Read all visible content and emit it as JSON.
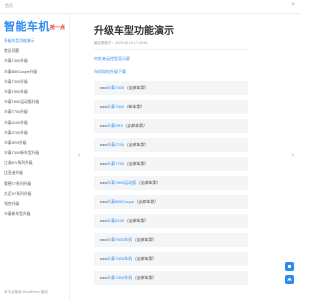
{
  "topbar": {
    "home": "首页",
    "close": "×"
  },
  "sidebar": {
    "logo": "智能车机",
    "badge": "抢一点",
    "items": [
      "升级车型功能演示",
      "常见问题",
      "众泰T300升级",
      "众泰B50Coupe升级",
      "众泰T300升级",
      "众泰T500升级",
      "众泰T600运动版升级",
      "众泰T700升级",
      "众泰Z100升级",
      "众泰Z700升级",
      "众泰SR9升级",
      "众泰T300新车型升级",
      "江淮iEV系列升级",
      "比亚迪升级",
      "奥德T7系列升级",
      "大迈X7系列升级",
      "领克升级",
      "众泰新车型升级"
    ],
    "footer": "本平台使用 WordPress 驱动"
  },
  "nav_arrows": {
    "left": "‹",
    "right": "›"
  },
  "main": {
    "title": "升级车型功能演示",
    "meta": "最后更新于：2020-06-19 17:30:54",
    "link1": "何处来云控型显示屏",
    "link2": "车机如何升级下载",
    "items": [
      {
        "prefix": "•••••",
        "model": "众泰T300",
        "suffix": "（全部车型）"
      },
      {
        "prefix": "•••••",
        "model": "众泰T300",
        "suffix": "（新车型）"
      },
      {
        "prefix": "•••••",
        "model": "众泰SR9",
        "suffix": "（全部车型）"
      },
      {
        "prefix": "•••••",
        "model": "众泰Z700",
        "suffix": "（全部车型）"
      },
      {
        "prefix": "•••••",
        "model": "众泰T700",
        "suffix": "（全部车型）"
      },
      {
        "prefix": "•••••",
        "model": "众泰T600运动版",
        "suffix": "（全部车型）"
      },
      {
        "prefix": "•••••",
        "model": "众泰B50Coupe",
        "suffix": "（全部车型）"
      },
      {
        "prefix": "•••••",
        "model": "众泰Z100",
        "suffix": "（全部车型）"
      },
      {
        "prefix": "•••••",
        "model": "众泰T500车机",
        "suffix": "（全部车型）"
      },
      {
        "prefix": "•••••",
        "model": "众泰T300车机",
        "suffix": "（全部车型）"
      },
      {
        "prefix": "•••••",
        "model": "众泰T300车机",
        "suffix": "（全部车型）"
      }
    ]
  },
  "colors": {
    "accent": "#2b8bf0",
    "badge": "#e03c31",
    "card": "#f4f5f7"
  }
}
